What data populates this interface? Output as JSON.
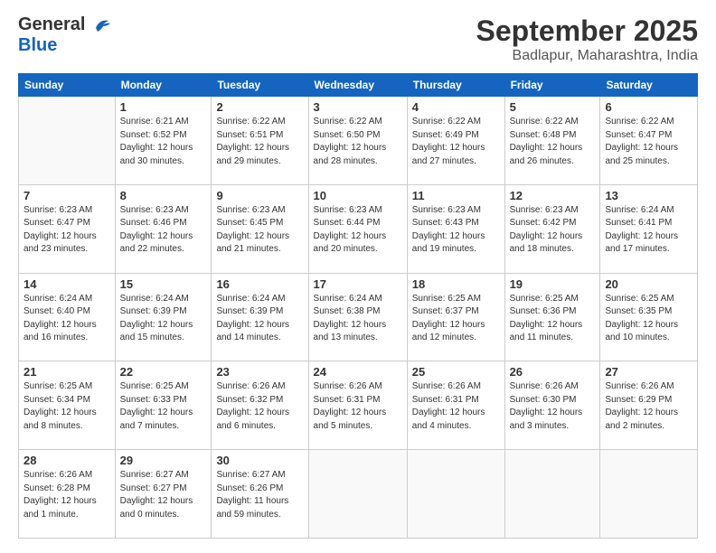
{
  "header": {
    "logo_line1": "General",
    "logo_line2": "Blue",
    "main_title": "September 2025",
    "subtitle": "Badlapur, Maharashtra, India"
  },
  "columns": [
    "Sunday",
    "Monday",
    "Tuesday",
    "Wednesday",
    "Thursday",
    "Friday",
    "Saturday"
  ],
  "weeks": [
    [
      {
        "day": "",
        "info": ""
      },
      {
        "day": "1",
        "info": "Sunrise: 6:21 AM\nSunset: 6:52 PM\nDaylight: 12 hours\nand 30 minutes."
      },
      {
        "day": "2",
        "info": "Sunrise: 6:22 AM\nSunset: 6:51 PM\nDaylight: 12 hours\nand 29 minutes."
      },
      {
        "day": "3",
        "info": "Sunrise: 6:22 AM\nSunset: 6:50 PM\nDaylight: 12 hours\nand 28 minutes."
      },
      {
        "day": "4",
        "info": "Sunrise: 6:22 AM\nSunset: 6:49 PM\nDaylight: 12 hours\nand 27 minutes."
      },
      {
        "day": "5",
        "info": "Sunrise: 6:22 AM\nSunset: 6:48 PM\nDaylight: 12 hours\nand 26 minutes."
      },
      {
        "day": "6",
        "info": "Sunrise: 6:22 AM\nSunset: 6:47 PM\nDaylight: 12 hours\nand 25 minutes."
      }
    ],
    [
      {
        "day": "7",
        "info": "Sunrise: 6:23 AM\nSunset: 6:47 PM\nDaylight: 12 hours\nand 23 minutes."
      },
      {
        "day": "8",
        "info": "Sunrise: 6:23 AM\nSunset: 6:46 PM\nDaylight: 12 hours\nand 22 minutes."
      },
      {
        "day": "9",
        "info": "Sunrise: 6:23 AM\nSunset: 6:45 PM\nDaylight: 12 hours\nand 21 minutes."
      },
      {
        "day": "10",
        "info": "Sunrise: 6:23 AM\nSunset: 6:44 PM\nDaylight: 12 hours\nand 20 minutes."
      },
      {
        "day": "11",
        "info": "Sunrise: 6:23 AM\nSunset: 6:43 PM\nDaylight: 12 hours\nand 19 minutes."
      },
      {
        "day": "12",
        "info": "Sunrise: 6:23 AM\nSunset: 6:42 PM\nDaylight: 12 hours\nand 18 minutes."
      },
      {
        "day": "13",
        "info": "Sunrise: 6:24 AM\nSunset: 6:41 PM\nDaylight: 12 hours\nand 17 minutes."
      }
    ],
    [
      {
        "day": "14",
        "info": "Sunrise: 6:24 AM\nSunset: 6:40 PM\nDaylight: 12 hours\nand 16 minutes."
      },
      {
        "day": "15",
        "info": "Sunrise: 6:24 AM\nSunset: 6:39 PM\nDaylight: 12 hours\nand 15 minutes."
      },
      {
        "day": "16",
        "info": "Sunrise: 6:24 AM\nSunset: 6:39 PM\nDaylight: 12 hours\nand 14 minutes."
      },
      {
        "day": "17",
        "info": "Sunrise: 6:24 AM\nSunset: 6:38 PM\nDaylight: 12 hours\nand 13 minutes."
      },
      {
        "day": "18",
        "info": "Sunrise: 6:25 AM\nSunset: 6:37 PM\nDaylight: 12 hours\nand 12 minutes."
      },
      {
        "day": "19",
        "info": "Sunrise: 6:25 AM\nSunset: 6:36 PM\nDaylight: 12 hours\nand 11 minutes."
      },
      {
        "day": "20",
        "info": "Sunrise: 6:25 AM\nSunset: 6:35 PM\nDaylight: 12 hours\nand 10 minutes."
      }
    ],
    [
      {
        "day": "21",
        "info": "Sunrise: 6:25 AM\nSunset: 6:34 PM\nDaylight: 12 hours\nand 8 minutes."
      },
      {
        "day": "22",
        "info": "Sunrise: 6:25 AM\nSunset: 6:33 PM\nDaylight: 12 hours\nand 7 minutes."
      },
      {
        "day": "23",
        "info": "Sunrise: 6:26 AM\nSunset: 6:32 PM\nDaylight: 12 hours\nand 6 minutes."
      },
      {
        "day": "24",
        "info": "Sunrise: 6:26 AM\nSunset: 6:31 PM\nDaylight: 12 hours\nand 5 minutes."
      },
      {
        "day": "25",
        "info": "Sunrise: 6:26 AM\nSunset: 6:31 PM\nDaylight: 12 hours\nand 4 minutes."
      },
      {
        "day": "26",
        "info": "Sunrise: 6:26 AM\nSunset: 6:30 PM\nDaylight: 12 hours\nand 3 minutes."
      },
      {
        "day": "27",
        "info": "Sunrise: 6:26 AM\nSunset: 6:29 PM\nDaylight: 12 hours\nand 2 minutes."
      }
    ],
    [
      {
        "day": "28",
        "info": "Sunrise: 6:26 AM\nSunset: 6:28 PM\nDaylight: 12 hours\nand 1 minute."
      },
      {
        "day": "29",
        "info": "Sunrise: 6:27 AM\nSunset: 6:27 PM\nDaylight: 12 hours\nand 0 minutes."
      },
      {
        "day": "30",
        "info": "Sunrise: 6:27 AM\nSunset: 6:26 PM\nDaylight: 11 hours\nand 59 minutes."
      },
      {
        "day": "",
        "info": ""
      },
      {
        "day": "",
        "info": ""
      },
      {
        "day": "",
        "info": ""
      },
      {
        "day": "",
        "info": ""
      }
    ]
  ]
}
